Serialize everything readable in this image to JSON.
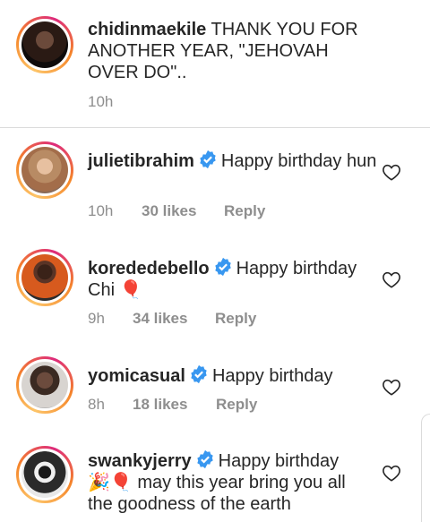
{
  "caption": {
    "username": "chidinmaekile",
    "text": " THANK YOU FOR ANOTHER YEAR, \"JEHOVAH OVER DO\"..",
    "time": "10h"
  },
  "comments": [
    {
      "username": "julietibrahim",
      "verified": true,
      "text": "Happy birthday hun",
      "time": "10h",
      "likes": "30 likes",
      "reply": "Reply"
    },
    {
      "username": "korededebello",
      "verified": true,
      "text": "Happy birthday Chi",
      "emoji": "🎈",
      "time": "9h",
      "likes": "34 likes",
      "reply": "Reply"
    },
    {
      "username": "yomicasual",
      "verified": true,
      "text": "Happy birthday",
      "time": "8h",
      "likes": "18 likes",
      "reply": "Reply"
    },
    {
      "username": "swankyjerry",
      "verified": true,
      "text_line1": "Happy birthday",
      "emoji": "🎉🎈",
      "text_line2": "may this year bring you all the goodness of the earth"
    }
  ],
  "icons": {
    "verified": "verified-badge-icon",
    "like": "heart-outline-icon"
  },
  "colors": {
    "verified": "#3897f0",
    "meta": "#8e8e8e",
    "text": "#262626"
  }
}
